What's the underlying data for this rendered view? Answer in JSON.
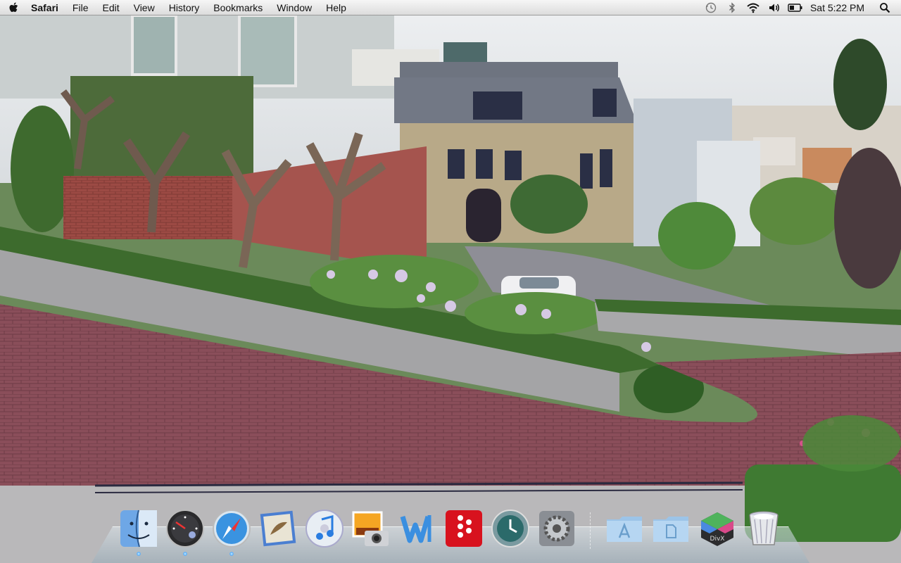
{
  "menubar": {
    "app_name": "Safari",
    "menus": [
      "File",
      "Edit",
      "View",
      "History",
      "Bookmarks",
      "Window",
      "Help"
    ],
    "status_icons": [
      "time-machine-icon",
      "bluetooth-icon",
      "wifi-icon",
      "volume-icon",
      "battery-icon"
    ],
    "clock": "Sat 5:22 PM",
    "spotlight_icon": "spotlight-search-icon"
  },
  "dock": {
    "apps": [
      {
        "name": "Finder",
        "icon": "finder-icon",
        "running": true
      },
      {
        "name": "Dashboard",
        "icon": "dashboard-icon",
        "running": true
      },
      {
        "name": "Safari",
        "icon": "safari-icon",
        "running": true
      },
      {
        "name": "Mail",
        "icon": "mail-icon",
        "running": false
      },
      {
        "name": "iTunes",
        "icon": "itunes-icon",
        "running": false
      },
      {
        "name": "iPhoto",
        "icon": "iphoto-icon",
        "running": false
      },
      {
        "name": "Word",
        "icon": "word-icon",
        "running": false
      },
      {
        "name": "Front Row",
        "icon": "front-row-icon",
        "running": false
      },
      {
        "name": "Time Machine",
        "icon": "time-machine-icon",
        "running": false
      },
      {
        "name": "System Preferences",
        "icon": "system-preferences-icon",
        "running": false
      }
    ],
    "stacks": [
      {
        "name": "Applications",
        "icon": "applications-folder-icon"
      },
      {
        "name": "Documents",
        "icon": "documents-folder-icon"
      },
      {
        "name": "DivX",
        "icon": "divx-icon"
      },
      {
        "name": "Trash",
        "icon": "trash-icon"
      }
    ]
  }
}
